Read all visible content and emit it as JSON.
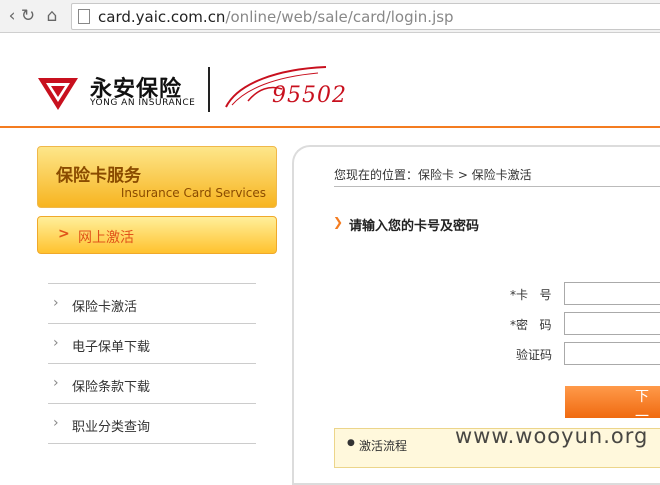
{
  "browser": {
    "back_icon": "reload-icon",
    "url_host": "card.yaic.com.cn",
    "url_path": "/online/web/sale/card/login.jsp"
  },
  "header": {
    "logo_cn": "永安保险",
    "logo_en": "YONG AN INSURANCE",
    "hotline": "95502",
    "accent_color": "#f47c20",
    "brand_red": "#c8101e"
  },
  "sidebar": {
    "title_cn": "保险卡服务",
    "title_en": "Insurance Card Services",
    "active_item": "网上激活",
    "items": [
      {
        "label": "保险卡激活"
      },
      {
        "label": "电子保单下载"
      },
      {
        "label": "保险条款下载"
      },
      {
        "label": "职业分类查询"
      }
    ]
  },
  "main": {
    "breadcrumb": "您现在的位置：保险卡 > 保险卡激活",
    "section_title": "请输入您的卡号及密码",
    "fields": {
      "card_label": "*卡   号",
      "card_value": "",
      "password_label": "*密   码",
      "password_value": "",
      "captcha_label": "验证码",
      "captcha_value": ""
    },
    "submit_label": "下 一",
    "flow_label": "激活流程"
  },
  "watermark": "www.wooyun.org"
}
